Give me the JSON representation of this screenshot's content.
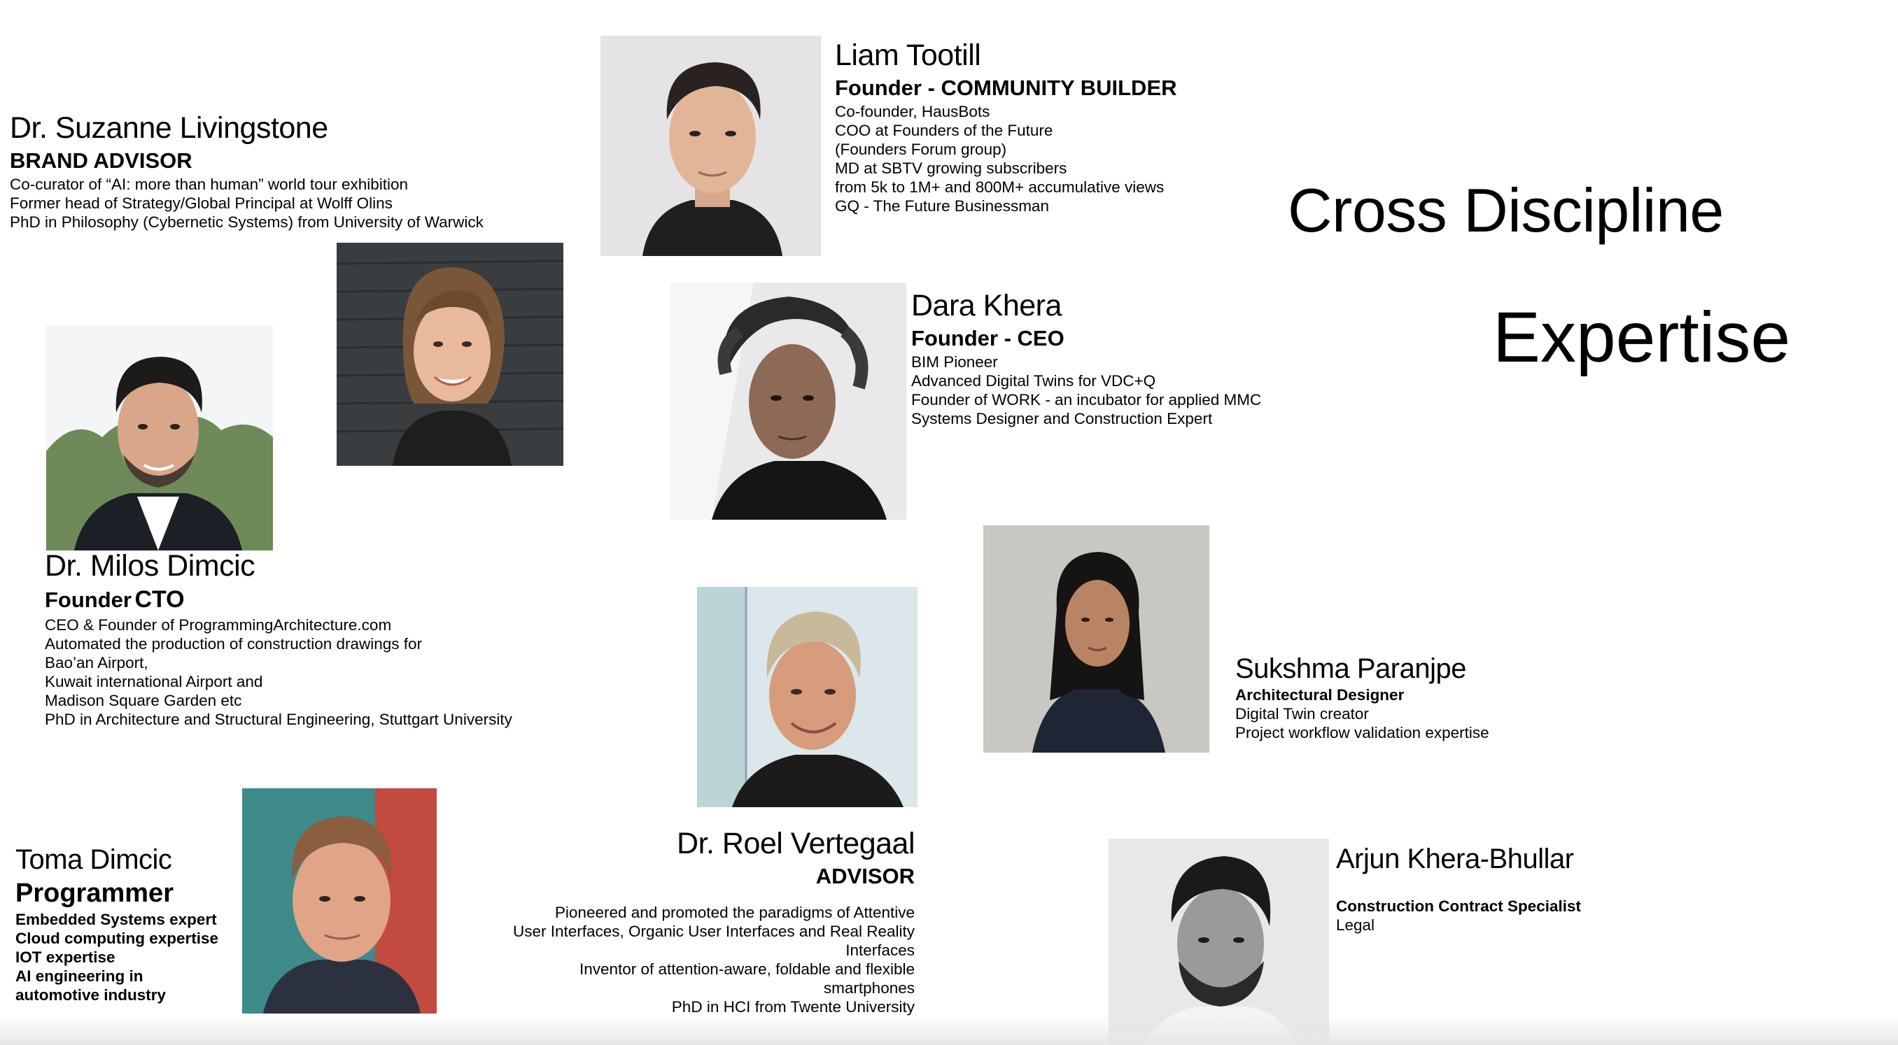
{
  "headline": {
    "line1": "Cross Discipline",
    "line2": "Expertise"
  },
  "people": {
    "suzanne": {
      "name": "Dr. Suzanne Livingstone",
      "role": "BRAND ADVISOR",
      "lines": [
        "Co-curator of “AI: more than human” world tour exhibition",
        "Former head of Strategy/Global Principal at Wolff Olins",
        "PhD in Philosophy (Cybernetic Systems) from University of Warwick"
      ]
    },
    "liam": {
      "name": "Liam Tootill",
      "role": "Founder - COMMUNITY BUILDER",
      "lines": [
        "Co-founder, HausBots",
        "COO at Founders of the Future",
        "(Founders Forum group)",
        "MD at SBTV growing subscribers",
        "from 5k to 1M+ and 800M+ accumulative views",
        "GQ - The Future Businessman"
      ]
    },
    "dara": {
      "name": "Dara Khera",
      "role": "Founder - CEO",
      "lines": [
        "BIM Pioneer",
        "Advanced Digital Twins  for  VDC+Q",
        "Founder of WORK - an incubator for applied MMC",
        "Systems Designer and Construction Expert"
      ]
    },
    "milos": {
      "name": "Dr. Milos Dimcic",
      "role_prefix": "Founder",
      "role_suffix": "CTO",
      "lines": [
        "CEO & Founder of ProgrammingArchitecture.com",
        "Automated the production of  construction drawings  for",
        "Bao’an Airport,",
        "Kuwait international Airport and",
        "Madison Square Garden etc",
        "PhD in Architecture and Structural Engineering, Stuttgart University"
      ]
    },
    "sukshma": {
      "name": "Sukshma Paranjpe",
      "role": "Architectural Designer",
      "lines": [
        "Digital Twin creator",
        "Project workflow validation expertise"
      ]
    },
    "toma": {
      "name": "Toma Dimcic",
      "role": "Programmer",
      "lines": [
        "Embedded Systems expert",
        "Cloud computing expertise",
        "IOT expertise",
        "AI engineering in",
        "automotive industry"
      ]
    },
    "roel": {
      "name": "Dr. Roel Vertegaal",
      "role": "ADVISOR",
      "lines": [
        "Pioneered and promoted the paradigms of Attentive",
        "User Interfaces, Organic User Interfaces and Real Reality",
        "Interfaces",
        "Inventor of attention-aware, foldable and flexible",
        "smartphones",
        "PhD in HCI from Twente University"
      ]
    },
    "arjun": {
      "name": "Arjun Khera-Bhullar",
      "role": "Construction Contract Specialist",
      "lines": [
        "Legal"
      ]
    }
  }
}
